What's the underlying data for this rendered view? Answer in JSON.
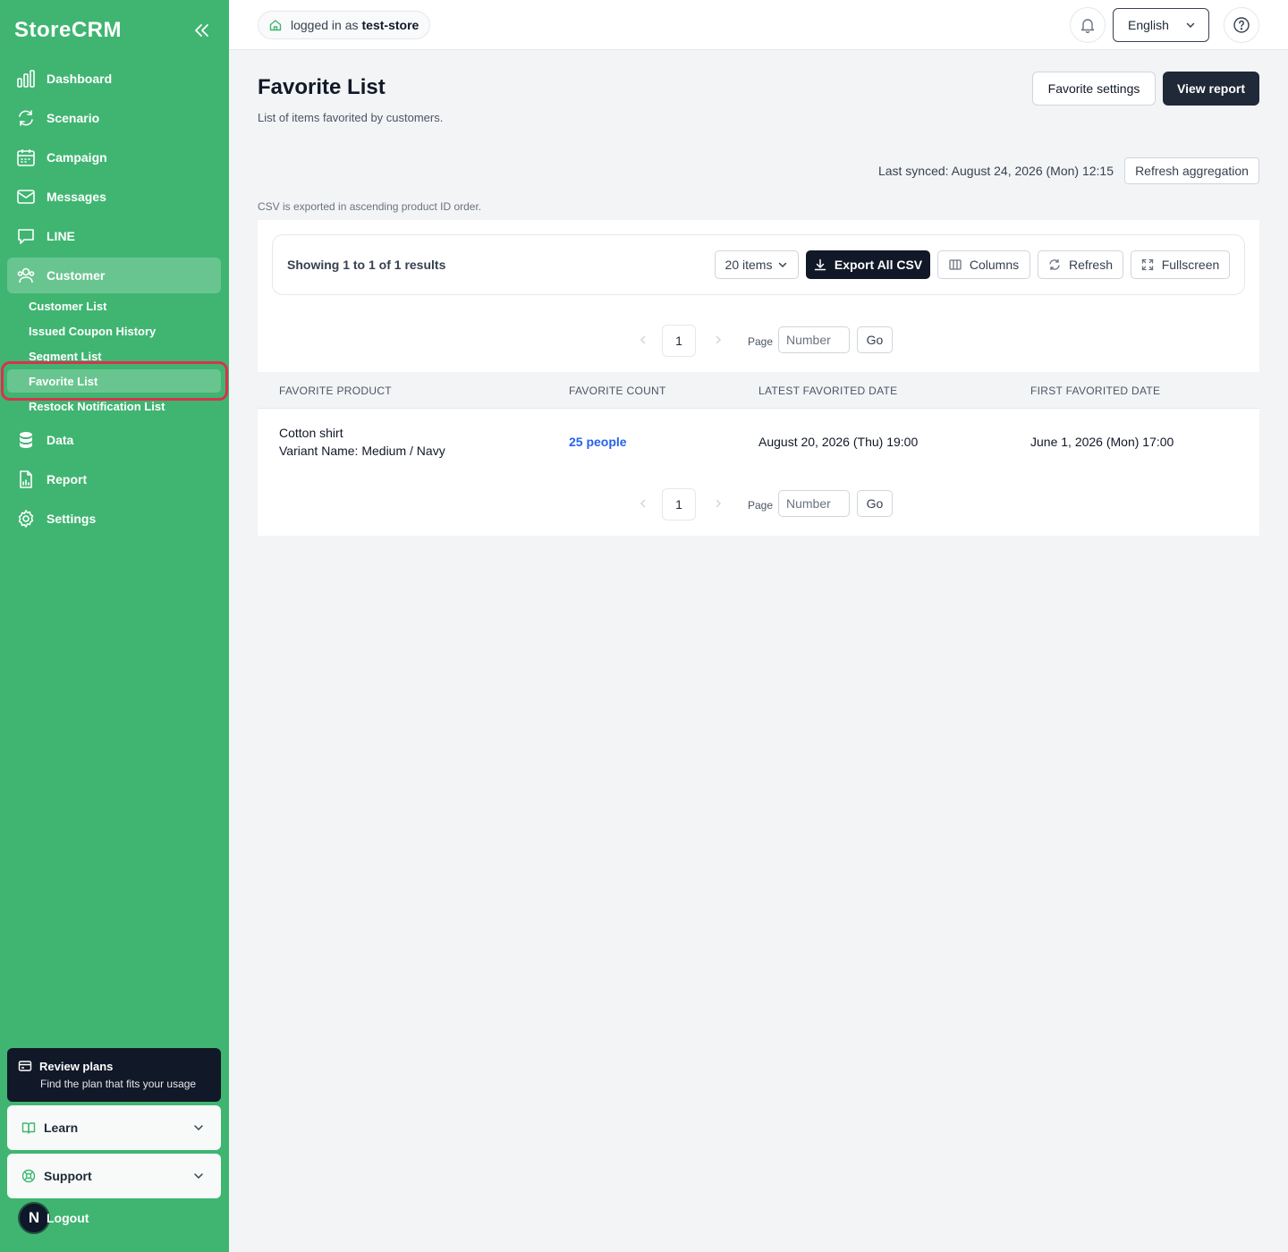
{
  "brand": "StoreCRM",
  "sidebar": {
    "nav": [
      {
        "label": "Dashboard",
        "icon": "bar-chart-icon"
      },
      {
        "label": "Scenario",
        "icon": "refresh-icon"
      },
      {
        "label": "Campaign",
        "icon": "calendar-icon"
      },
      {
        "label": "Messages",
        "icon": "mail-icon"
      },
      {
        "label": "LINE",
        "icon": "chat-icon"
      },
      {
        "label": "Customer",
        "icon": "users-icon"
      }
    ],
    "customer_sub": [
      "Customer List",
      "Issued Coupon History",
      "Segment List",
      "Favorite List",
      "Restock Notification List"
    ],
    "nav_bottom": [
      {
        "label": "Data",
        "icon": "database-icon"
      },
      {
        "label": "Report",
        "icon": "report-icon"
      },
      {
        "label": "Settings",
        "icon": "gear-icon"
      }
    ],
    "plan": {
      "title": "Review plans",
      "subtitle": "Find the plan that fits your usage"
    },
    "learn": "Learn",
    "support": "Support",
    "avatar_initial": "N",
    "logout": "Logout"
  },
  "topbar": {
    "login_prefix": "logged in as",
    "store": "test-store",
    "language": "English"
  },
  "page": {
    "title": "Favorite List",
    "subtitle": "List of items favorited by customers.",
    "favorite_settings": "Favorite settings",
    "view_report": "View report",
    "last_synced": "Last synced: August 24, 2026 (Mon) 12:15",
    "refresh_aggregation": "Refresh aggregation",
    "csv_note": "CSV is exported in ascending product ID order."
  },
  "toolbar": {
    "results": "Showing 1 to 1 of 1 results",
    "page_size": "20 items",
    "export": "Export All CSV",
    "columns": "Columns",
    "refresh": "Refresh",
    "fullscreen": "Fullscreen"
  },
  "pagination": {
    "current": "1",
    "page_label": "Page",
    "placeholder": "Number",
    "go": "Go"
  },
  "table": {
    "headers": [
      "FAVORITE PRODUCT",
      "FAVORITE COUNT",
      "LATEST FAVORITED DATE",
      "FIRST FAVORITED DATE"
    ],
    "rows": [
      {
        "product": "Cotton shirt",
        "variant": "Variant Name: Medium / Navy",
        "count": "25 people",
        "latest": "August 20, 2026 (Thu) 19:00",
        "first": "June 1, 2026 (Mon) 17:00"
      }
    ]
  },
  "colors": {
    "sidebar": "#3fb571",
    "dark_button": "#1f2937",
    "link": "#2563eb",
    "highlight": "#d6334f"
  }
}
